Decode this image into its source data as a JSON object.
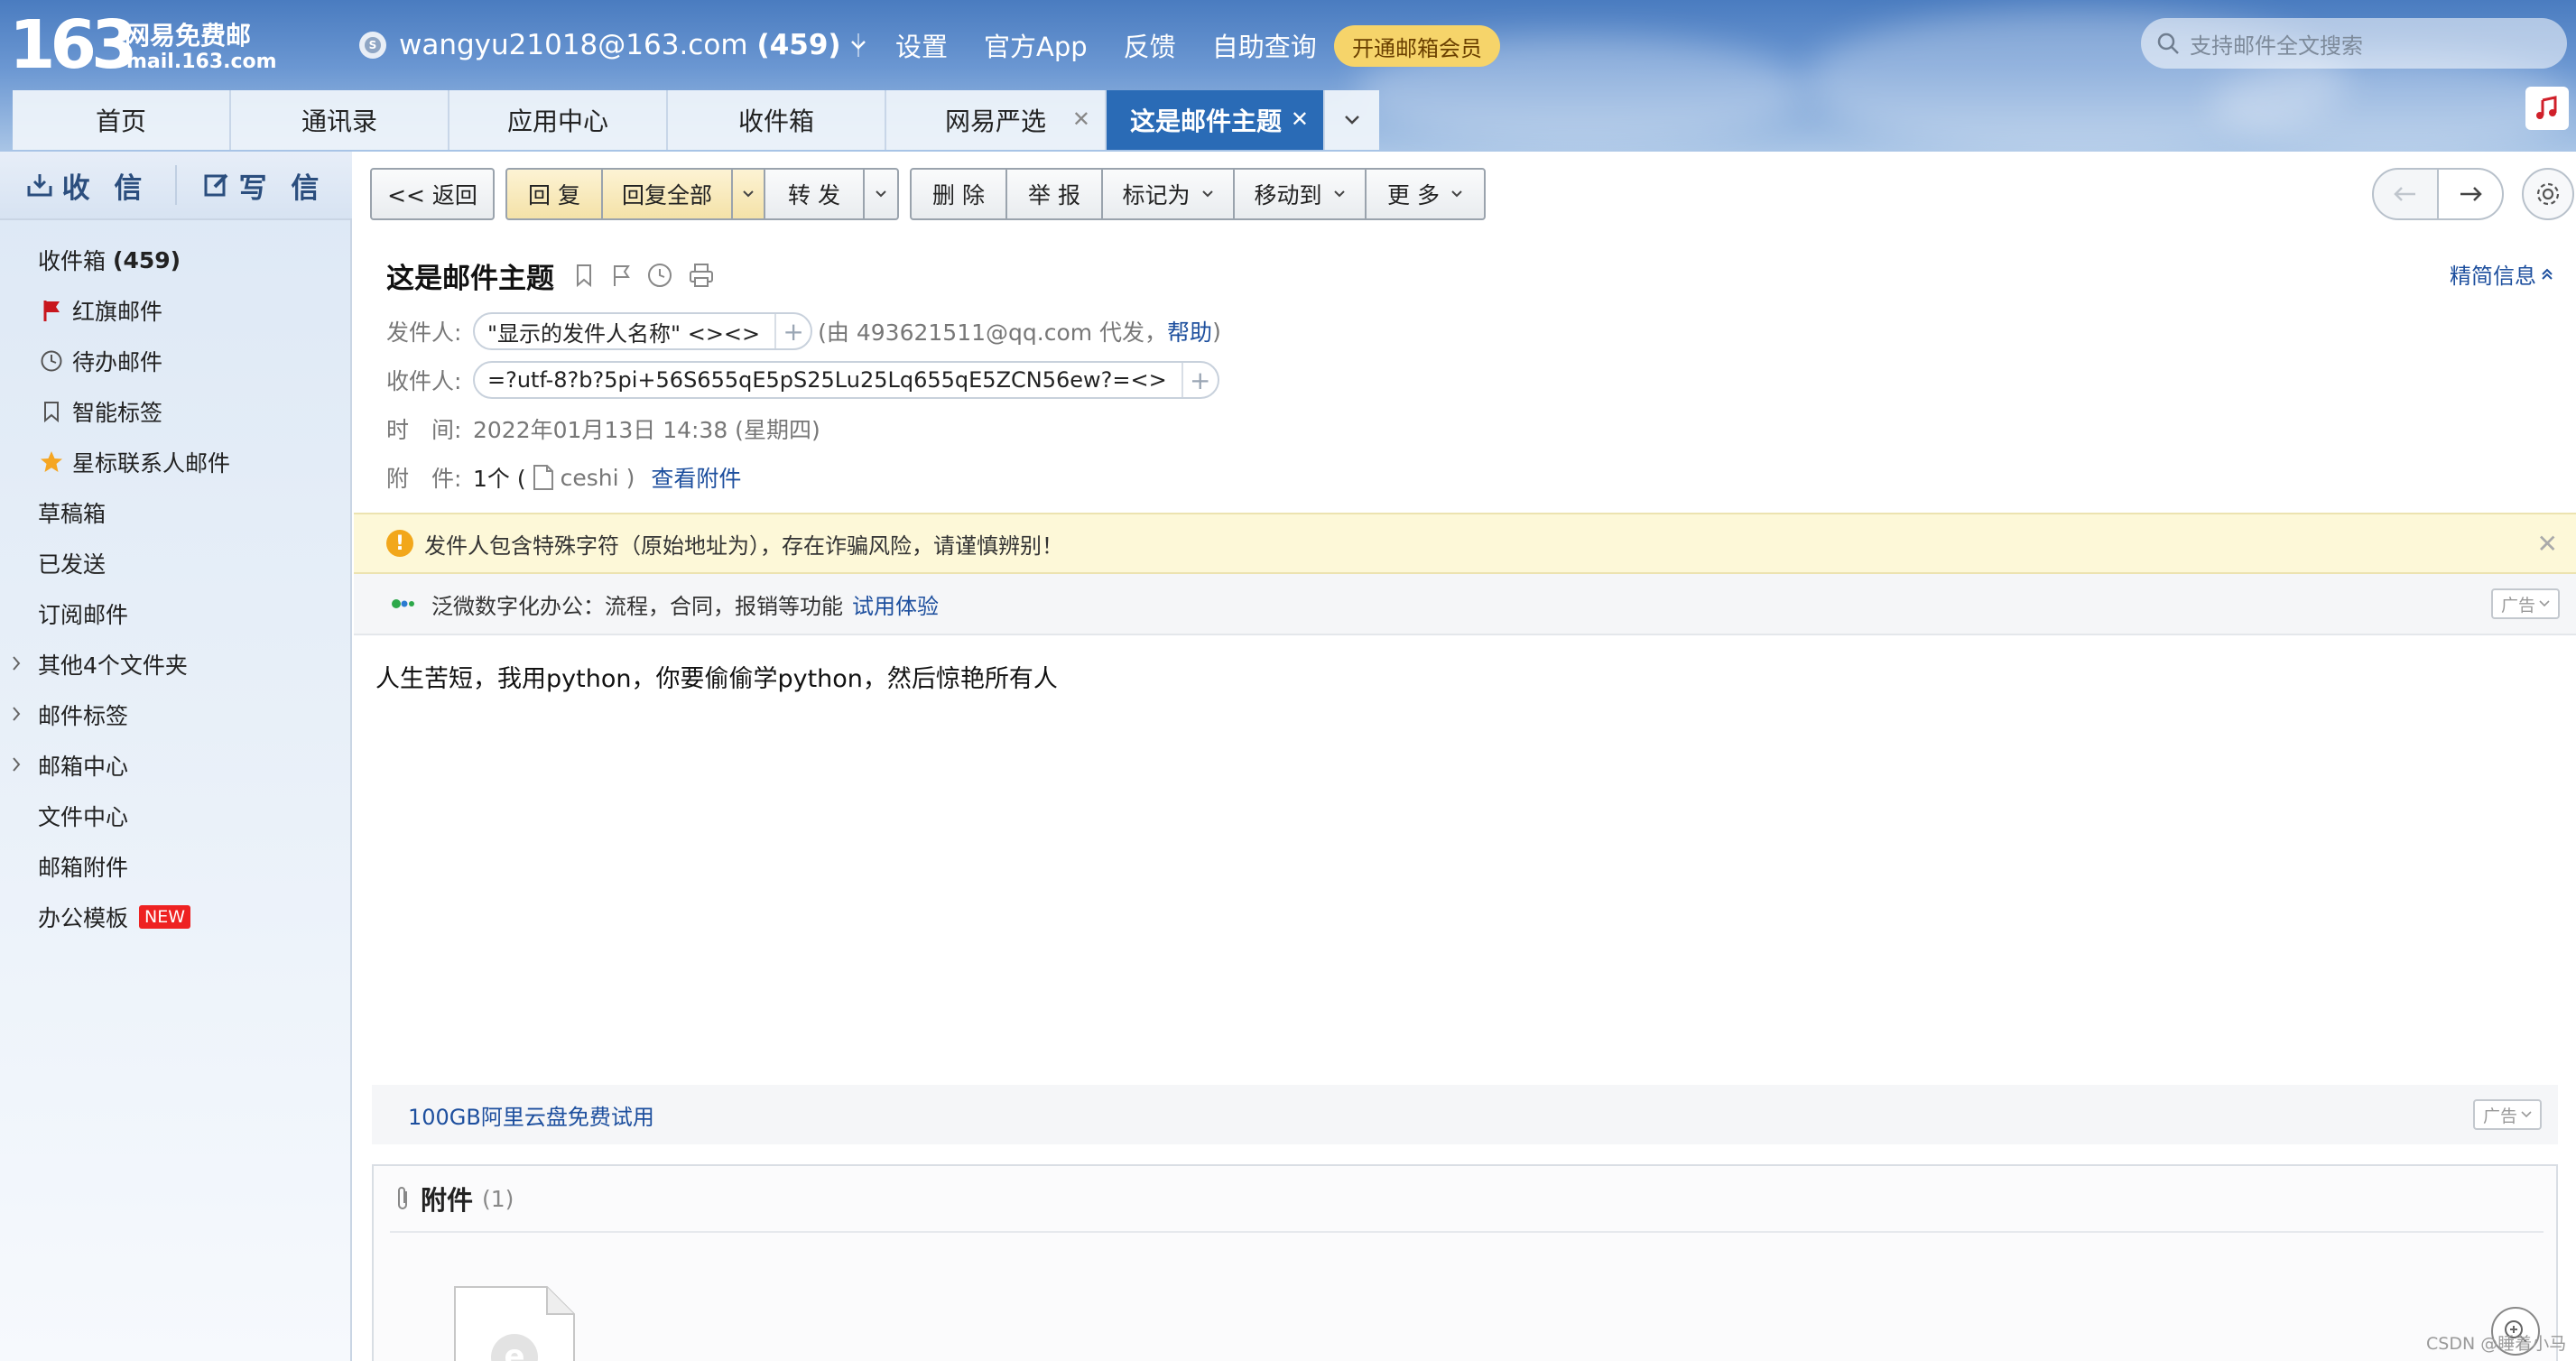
{
  "header": {
    "logo_number": "163",
    "logo_cn": "网易免费邮",
    "logo_url": "mail.163.com",
    "account": "wangyu21018@163.com",
    "account_count": "(459)",
    "nav": [
      "设置",
      "官方App",
      "反馈",
      "自助查询"
    ],
    "vip": "开通邮箱会员",
    "search_placeholder": "支持邮件全文搜索"
  },
  "tabs": [
    {
      "label": "首页"
    },
    {
      "label": "通讯录"
    },
    {
      "label": "应用中心"
    },
    {
      "label": "收件箱"
    },
    {
      "label": "网易严选",
      "closable": true
    },
    {
      "label": "这是邮件主题",
      "closable": true,
      "active": true
    }
  ],
  "sidebar": {
    "receive": "收 信",
    "compose": "写 信",
    "folders": [
      {
        "label": "收件箱",
        "count": "(459)",
        "icon": "none"
      },
      {
        "label": "红旗邮件",
        "icon": "red-flag-icon"
      },
      {
        "label": "待办邮件",
        "icon": "clock-icon"
      },
      {
        "label": "智能标签",
        "icon": "bookmark-icon"
      },
      {
        "label": "星标联系人邮件",
        "icon": "star-icon"
      },
      {
        "label": "草稿箱",
        "icon": "none"
      },
      {
        "label": "已发送",
        "icon": "none"
      },
      {
        "label": "订阅邮件",
        "icon": "none"
      },
      {
        "label": "其他4个文件夹",
        "icon": "none",
        "expandable": true
      },
      {
        "label": "邮件标签",
        "icon": "none",
        "expandable": true
      },
      {
        "label": "邮箱中心",
        "icon": "none",
        "expandable": true
      },
      {
        "label": "文件中心",
        "icon": "none"
      },
      {
        "label": "邮箱附件",
        "icon": "none"
      },
      {
        "label": "办公模板",
        "icon": "none",
        "badge": "NEW"
      }
    ]
  },
  "toolbar": {
    "back": "<< 返回",
    "reply": "回 复",
    "reply_all": "回复全部",
    "forward": "转 发",
    "delete": "删 除",
    "report": "举 报",
    "mark_as": "标记为",
    "move_to": "移动到",
    "more": "更 多"
  },
  "mail": {
    "subject": "这是邮件主题",
    "brief": "精简信息",
    "from_label": "发件人:",
    "from_value": "\"显示的发件人名称\" <><>",
    "from_proxy_pre": "(由 493621511@qq.com 代发，",
    "from_proxy_link": "帮助",
    "from_proxy_post": ")",
    "to_label": "收件人:",
    "to_value": "=?utf-8?b?5pi+56S655qE5pS25Lu25Lq655qE5ZCN56ew?=<>",
    "time_label": "时　间:",
    "time_value": "2022年01月13日 14:38 (星期四)",
    "attach_label": "附　件:",
    "attach_count_pre": "1个 (",
    "attach_name": "ceshi",
    "attach_count_post": ")",
    "attach_link": "查看附件",
    "warning": "发件人包含特殊字符（原始地址为），存在诈骗风险，请谨慎辨别！",
    "ad1_text": "泛微数字化办公：流程，合同，报销等功能",
    "ad1_link": "试用体验",
    "ad_tag": "广告",
    "body": "人生苦短，我用python，你要偷偷学python，然后惊艳所有人",
    "ad2_text": "100GB阿里云盘免费试用",
    "attachments_title": "附件",
    "attachments_count": "(1)"
  },
  "watermark": "CSDN @睡着小马",
  "colors": {
    "header_blue": "#4a7cc0",
    "active_tab": "#2a6bb6",
    "link": "#1d4f9e",
    "vip": "#f6d46a",
    "warning_bg": "#fdf8d8",
    "new_badge": "#e22222"
  }
}
